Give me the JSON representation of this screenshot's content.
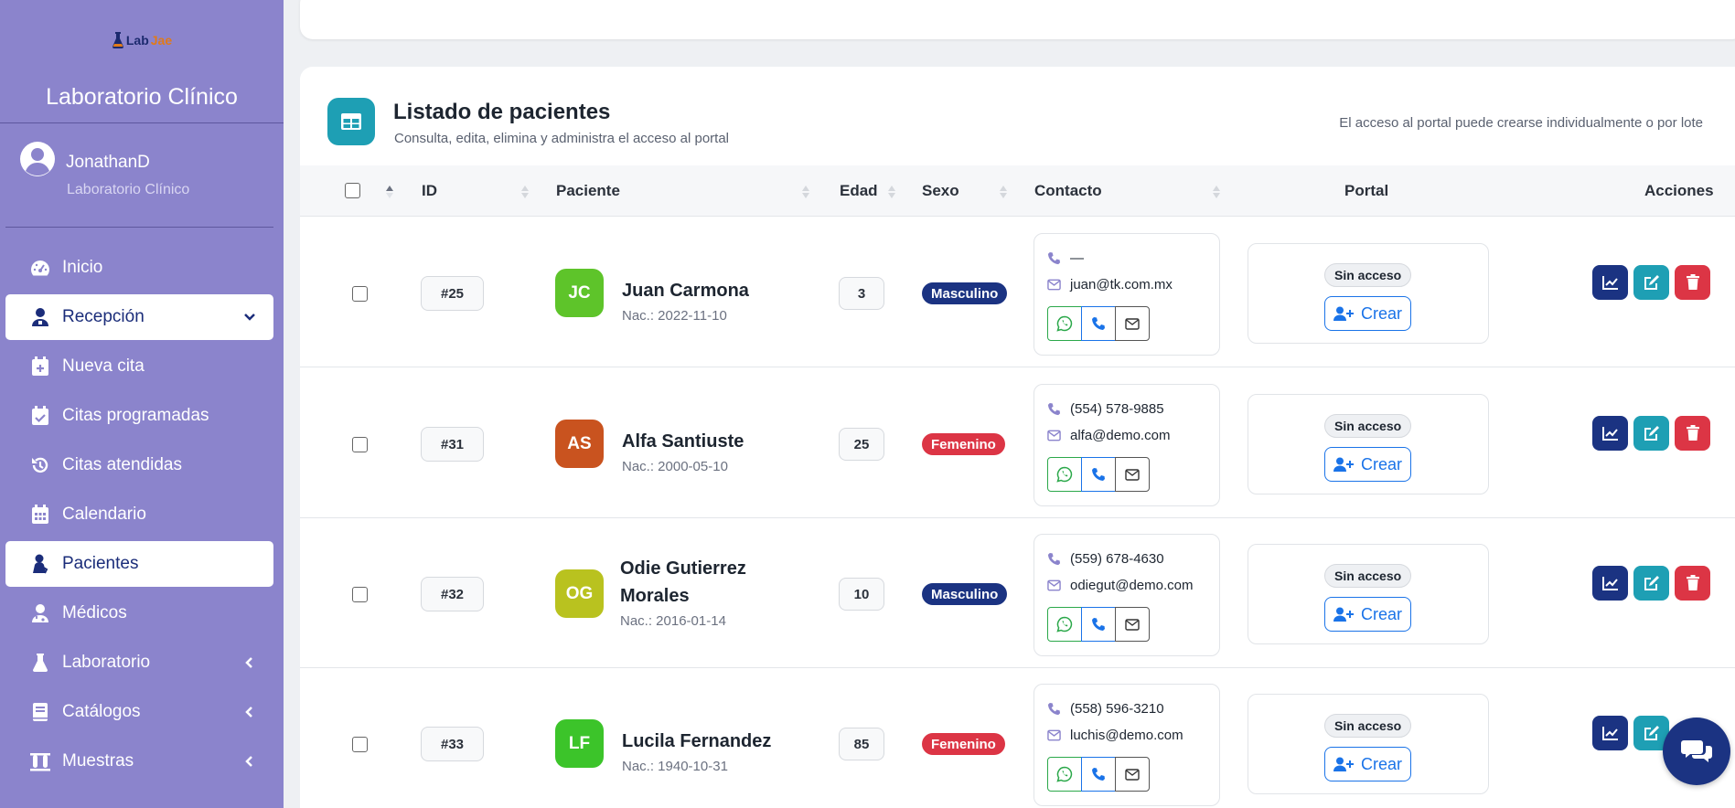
{
  "sidebar": {
    "logo": {
      "part1": "Lab",
      "part2": "Jae"
    },
    "brand": "Laboratorio Clínico",
    "user": {
      "name": "JonathanD",
      "role": "Laboratorio Clínico"
    },
    "items": [
      {
        "label": "Inicio",
        "icon": "gauge-icon"
      },
      {
        "label": "Recepción",
        "icon": "user-doctor-icon",
        "active": true,
        "arrow": "chevron-down-icon"
      },
      {
        "label": "Nueva cita",
        "icon": "calendar-plus-icon"
      },
      {
        "label": "Citas programadas",
        "icon": "calendar-check-icon"
      },
      {
        "label": "Citas atendidas",
        "icon": "history-icon"
      },
      {
        "label": "Calendario",
        "icon": "calendar-icon"
      },
      {
        "label": "Pacientes",
        "icon": "patient-icon",
        "active": true
      },
      {
        "label": "Médicos",
        "icon": "doctor-icon"
      },
      {
        "label": "Laboratorio",
        "icon": "flask-icon",
        "arrow": "chevron-left-icon"
      },
      {
        "label": "Catálogos",
        "icon": "book-icon",
        "arrow": "chevron-left-icon"
      },
      {
        "label": "Muestras",
        "icon": "vials-icon",
        "arrow": "chevron-left-icon"
      }
    ]
  },
  "panel": {
    "title": "Listado de pacientes",
    "subtitle": "Consulta, edita, elimina y administra el acceso al portal",
    "note": "El acceso al portal puede crearse individualmente o por lote"
  },
  "table": {
    "headers": {
      "id": "ID",
      "patient": "Paciente",
      "age": "Edad",
      "sex": "Sexo",
      "contact": "Contacto",
      "portal": "Portal",
      "actions": "Acciones"
    },
    "portal_status": "Sin acceso",
    "create_label": "Crear",
    "rows": [
      {
        "id": "#25",
        "initials": "JC",
        "avatar_color": "#5ec42a",
        "name": "Juan Carmona",
        "name_lines": [
          "Juan Carmona"
        ],
        "dob": "Nac.: 2022-11-10",
        "age": "3",
        "sex": "Masculino",
        "phone": "—",
        "email": "juan@tk.com.mx"
      },
      {
        "id": "#31",
        "initials": "AS",
        "avatar_color": "#c9531f",
        "name": "Alfa Santiuste",
        "name_lines": [
          "Alfa Santiuste"
        ],
        "dob": "Nac.: 2000-05-10",
        "age": "25",
        "sex": "Femenino",
        "phone": "(554) 578-9885",
        "email": "alfa@demo.com"
      },
      {
        "id": "#32",
        "initials": "OG",
        "avatar_color": "#b9c21f",
        "name": "Odie Gutierrez Morales",
        "name_lines": [
          "Odie Gutierrez",
          "Morales"
        ],
        "dob": "Nac.: 2016-01-14",
        "age": "10",
        "sex": "Masculino",
        "phone": "(559) 678-4630",
        "email": "odiegut@demo.com"
      },
      {
        "id": "#33",
        "initials": "LF",
        "avatar_color": "#3cc42a",
        "name": "Lucila Fernandez",
        "name_lines": [
          "Lucila Fernandez"
        ],
        "dob": "Nac.: 1940-10-31",
        "age": "85",
        "sex": "Femenino",
        "phone": "(558) 596-3210",
        "email": "luchis@demo.com"
      }
    ]
  },
  "colors": {
    "sidebar_bg": "#8b84cc",
    "primary": "#1b3382",
    "teal": "#1e9fb4",
    "danger": "#dc3545",
    "link_blue": "#1a73e8",
    "whatsapp_green": "#2ba84a"
  }
}
